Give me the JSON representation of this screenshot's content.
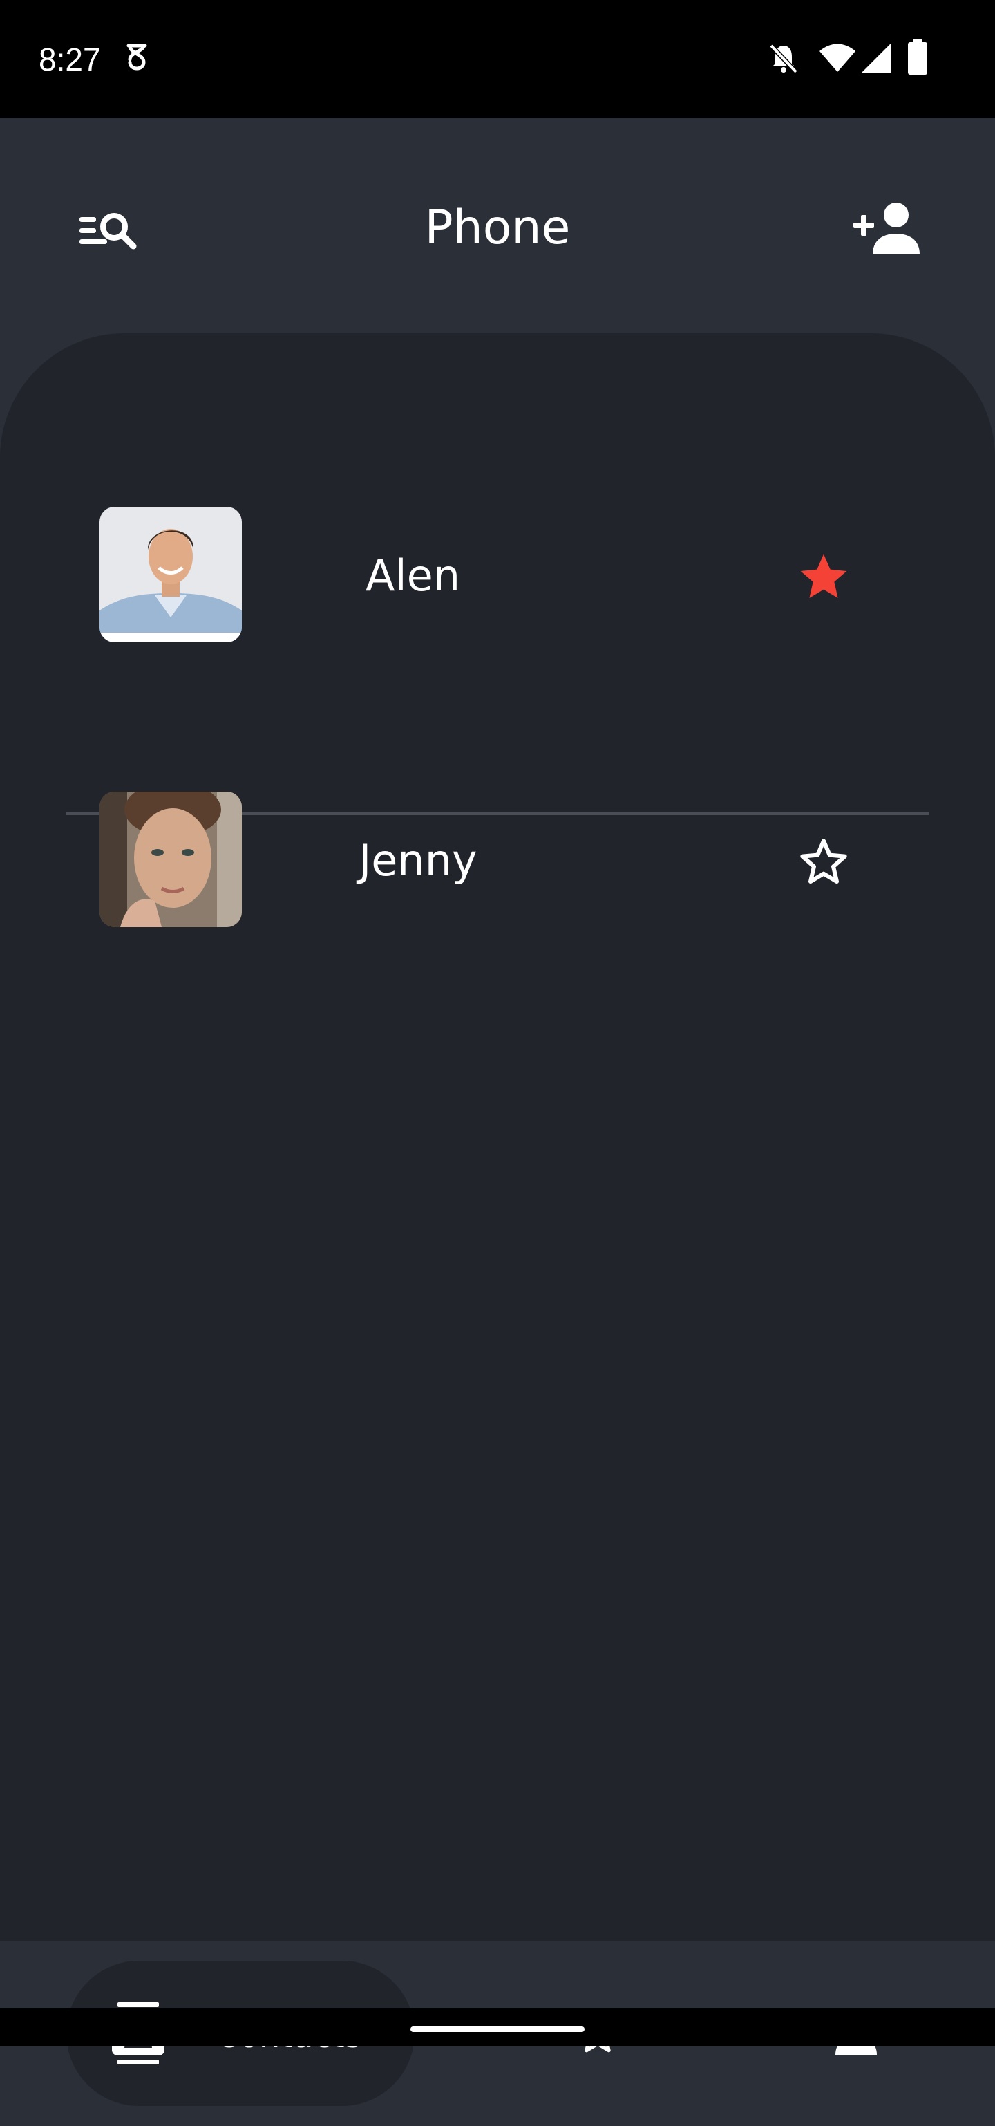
{
  "status_bar": {
    "time": "8:27",
    "icons": [
      "lab-icon",
      "notifications-off-icon",
      "wifi-icon",
      "cellular-icon",
      "battery-icon"
    ]
  },
  "header": {
    "title": "Phone",
    "left_icon": "search-list-icon",
    "right_icon": "add-person-icon"
  },
  "contacts": [
    {
      "name": "Alen",
      "favorite": true
    },
    {
      "name": "Jenny",
      "favorite": false
    }
  ],
  "bottom_nav": {
    "items": [
      {
        "label": "Contacts",
        "icon": "contacts-icon",
        "active": true
      },
      {
        "label": "",
        "icon": "star-outline-icon",
        "active": false
      },
      {
        "label": "",
        "icon": "person-icon",
        "active": false
      }
    ]
  },
  "colors": {
    "background": "#2b2f37",
    "sheet": "#22242c",
    "favorite_star": "#f44336",
    "text": "#ffffff"
  }
}
